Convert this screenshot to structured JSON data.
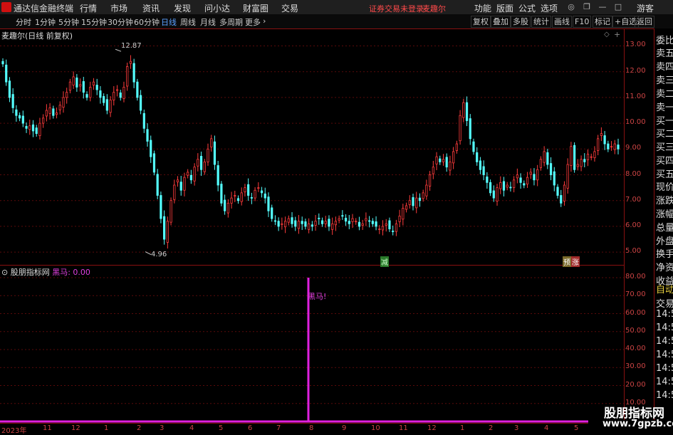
{
  "menubar": {
    "app_title": "通达信金融终端",
    "items": [
      "行情",
      "市场",
      "资讯",
      "发现",
      "问小达",
      "财富圈",
      "交易"
    ],
    "status": "证券交易未登录",
    "stock": "麦趣尔",
    "right_items": [
      "功能",
      "版面",
      "公式",
      "选项"
    ],
    "guest": "游客"
  },
  "toolbar": {
    "periods": [
      "分时",
      "1分钟",
      "5分钟",
      "15分钟",
      "30分钟",
      "60分钟",
      "日线",
      "周线",
      "月线",
      "多周期",
      "更多"
    ],
    "selected_period": "日线",
    "buttons": [
      "复权",
      "叠加",
      "多股",
      "统计",
      "画线",
      "F10",
      "标记",
      "+自选",
      "返回"
    ]
  },
  "chart_header": {
    "label": "麦趣尔(日线 前复权)"
  },
  "indicator": {
    "name": "股朋指标网",
    "series_label": "黑马: 0.00",
    "signal_label": "黑马!"
  },
  "annotations": {
    "high": "12.87",
    "low": "4.96",
    "mark1": "减",
    "mark2": "预",
    "mark3": "涨"
  },
  "right_panel": [
    "委比",
    "卖五",
    "卖四",
    "卖三",
    "卖二",
    "卖一",
    "买一",
    "买二",
    "买三",
    "买四",
    "买五",
    "现价",
    "涨跌",
    "涨幅",
    "总量",
    "外盘",
    "换手",
    "净资",
    "收益",
    "自动",
    "交易",
    "14:56",
    "14:56",
    "14:56",
    "14:56",
    "14:56",
    "14:56",
    "14:56"
  ],
  "watermark": {
    "line1": "股朋指标网",
    "line2": "www.7gpzb.com"
  },
  "chart_data": [
    {
      "type": "candlestick",
      "title": "麦趣尔(日线 前复权)",
      "y_ticks": [
        "13.00",
        "12.00",
        "11.00",
        "10.00",
        "9.00",
        "8.00",
        "7.00",
        "6.00",
        "5.00"
      ],
      "ylim": [
        4.7,
        13.4
      ],
      "x_ticks": [
        "2023年",
        "11",
        "12",
        "1",
        "2",
        "3",
        "4",
        "5",
        "6",
        "7",
        "8",
        "9",
        "10",
        "11",
        "12",
        "1",
        "2",
        "3",
        "4",
        "5"
      ],
      "close": [
        12.3,
        11.6,
        11.0,
        10.6,
        10.3,
        10.2,
        10.0,
        9.8,
        9.9,
        9.7,
        9.6,
        10.0,
        10.2,
        10.5,
        10.6,
        10.3,
        10.4,
        10.7,
        11.0,
        11.2,
        11.6,
        11.8,
        11.4,
        11.5,
        11.2,
        11.0,
        11.4,
        11.6,
        11.3,
        11.0,
        10.8,
        10.5,
        10.9,
        11.2,
        11.3,
        11.0,
        11.4,
        12.2,
        12.4,
        11.6,
        11.0,
        10.5,
        9.8,
        9.3,
        8.7,
        8.1,
        7.2,
        6.3,
        5.5,
        6.2,
        7.0,
        7.6,
        7.8,
        7.4,
        7.9,
        8.1,
        7.8,
        8.3,
        8.6,
        8.2,
        8.5,
        9.0,
        9.4,
        8.4,
        7.6,
        6.9,
        6.6,
        6.9,
        7.1,
        7.2,
        7.0,
        7.3,
        7.5,
        7.2,
        7.1,
        7.4,
        7.5,
        7.3,
        7.1,
        6.6,
        6.3,
        6.2,
        6.0,
        6.1,
        6.2,
        6.3,
        6.1,
        6.0,
        6.2,
        6.1,
        6.0,
        6.1,
        6.0,
        6.2,
        6.3,
        6.1,
        6.2,
        6.0,
        6.1,
        6.2,
        6.3,
        6.4,
        6.2,
        6.1,
        6.3,
        6.2,
        6.0,
        6.1,
        6.3,
        6.2,
        6.1,
        6.0,
        5.9,
        6.0,
        6.1,
        5.9,
        5.8,
        6.1,
        6.4,
        6.7,
        6.8,
        7.0,
        6.8,
        7.1,
        7.0,
        7.3,
        7.6,
        8.0,
        8.3,
        8.7,
        8.5,
        8.6,
        8.3,
        8.5,
        8.9,
        9.2,
        10.3,
        10.8,
        10.1,
        9.4,
        8.9,
        8.5,
        8.2,
        8.0,
        7.7,
        7.3,
        7.1,
        7.5,
        7.7,
        7.4,
        7.6,
        7.5,
        7.8,
        8.0,
        7.7,
        7.6,
        7.9,
        8.1,
        7.8,
        8.2,
        8.6,
        8.9,
        8.4,
        8.0,
        7.6,
        7.2,
        6.9,
        7.6,
        8.4,
        9.1,
        8.2,
        8.4,
        8.6,
        8.5,
        8.8,
        8.7,
        8.9,
        9.4,
        9.6,
        9.2,
        9.0,
        9.1,
        9.2,
        9.0
      ]
    },
    {
      "type": "bar",
      "title": "股朋指标网",
      "series": [
        {
          "name": "黑马",
          "values": [
            0,
            80,
            0
          ]
        }
      ],
      "y_ticks": [
        "80.00",
        "70.00",
        "60.00",
        "50.00",
        "40.00",
        "30.00",
        "20.00",
        "10.00"
      ],
      "ylim": [
        0,
        80
      ],
      "signal_x_tick": "8"
    }
  ]
}
